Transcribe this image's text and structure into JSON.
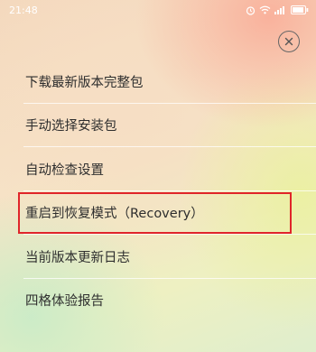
{
  "status_bar": {
    "time": "21:48",
    "icons": [
      "alarm-icon",
      "wifi-icon",
      "signal-icon",
      "battery-icon"
    ]
  },
  "close_icon": "close-icon",
  "menu": {
    "items": [
      {
        "label": "下载最新版本完整包"
      },
      {
        "label": "手动选择安装包"
      },
      {
        "label": "自动检查设置"
      },
      {
        "label": "重启到恢复模式（Recovery）",
        "highlighted": true
      },
      {
        "label": "当前版本更新日志"
      },
      {
        "label": "四格体验报告"
      }
    ]
  },
  "colors": {
    "highlight_border": "#e0252a",
    "text": "#2e2e2e"
  }
}
